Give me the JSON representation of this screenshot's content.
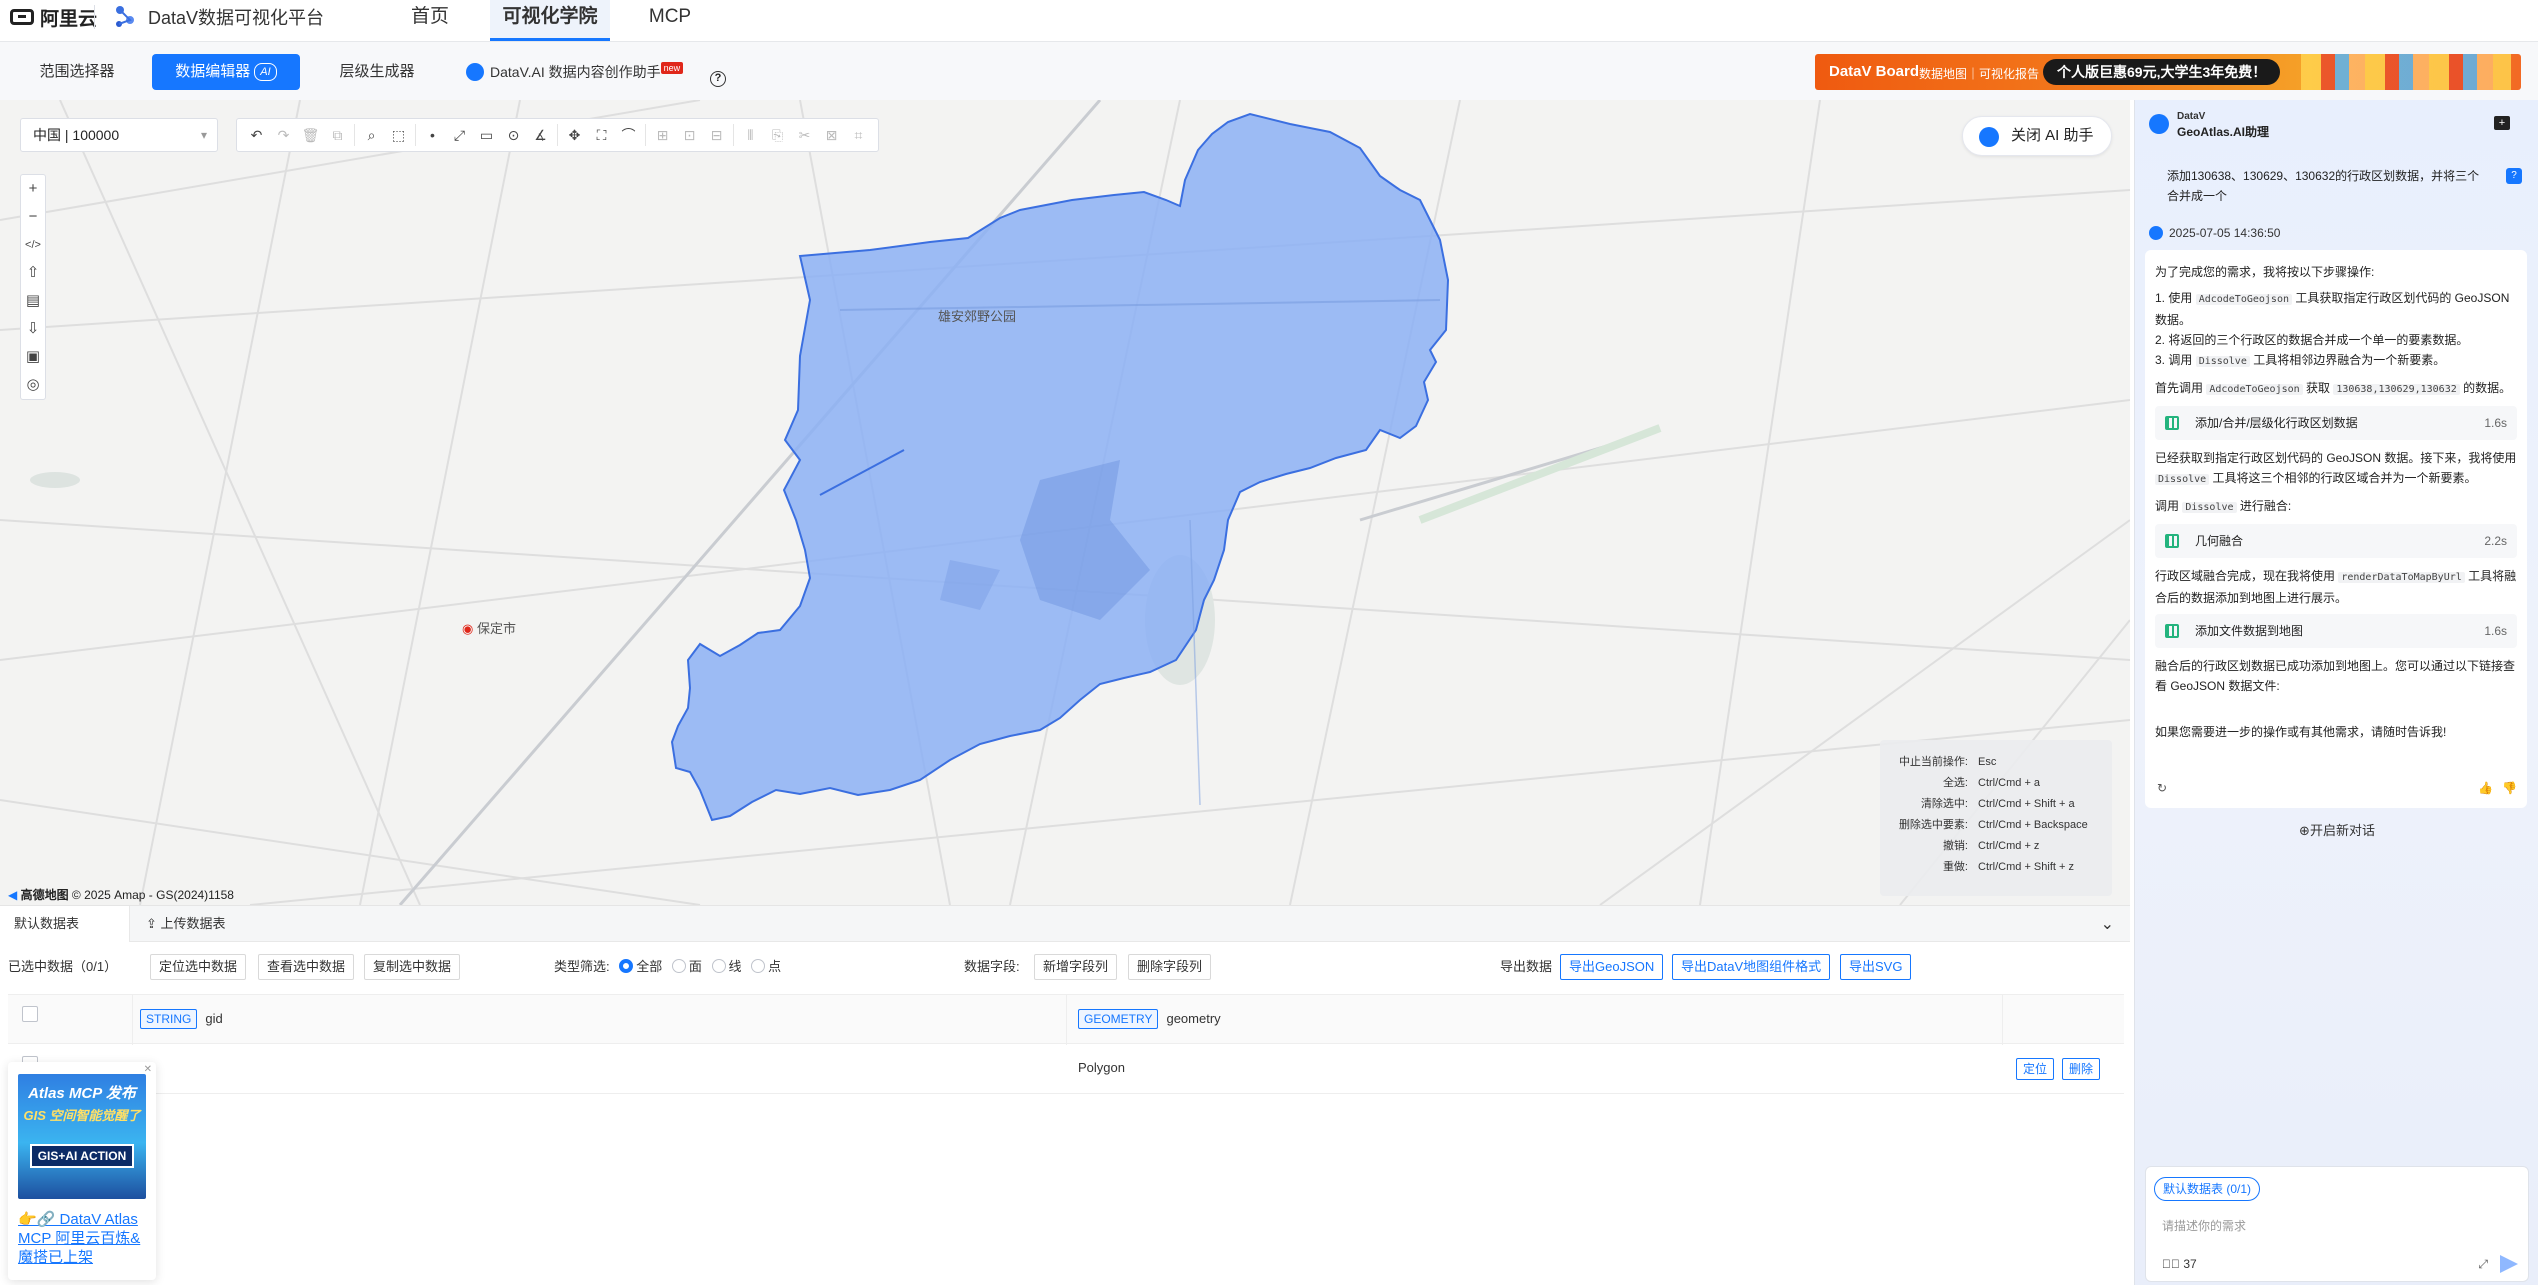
{
  "topbar": {
    "logo": "阿里云",
    "brand": "DataV数据可视化平台",
    "nav": [
      "首页",
      "可视化学院",
      "MCP"
    ],
    "active_nav": "可视化学院"
  },
  "subtabs": {
    "items": [
      "范围选择器",
      "数据编辑器",
      "层级生成器",
      "DataV.AI 数据内容创作助手"
    ],
    "active": "数据编辑器",
    "ai_badge": "AI",
    "new_badge": "new"
  },
  "banner": {
    "brand": "DataV Board",
    "sub": "数据地图｜可视化报告",
    "promo": "个人版巨惠69元,大学生3年免费！"
  },
  "map": {
    "region_select": "中国 | 100000",
    "ai_toggle": "关闭 AI 助手",
    "labels": {
      "park": "雄安郊野公园",
      "city": "保定市"
    },
    "attribution": "© 2025 Amap - GS(2024)1158",
    "amap_logo": "高德地图",
    "polygon_color": "#8cb0f5",
    "shortcuts": [
      {
        "k": "中止当前操作:",
        "v": "Esc"
      },
      {
        "k": "全选:",
        "v": "Ctrl/Cmd + a"
      },
      {
        "k": "清除选中:",
        "v": "Ctrl/Cmd + Shift + a"
      },
      {
        "k": "删除选中要素:",
        "v": "Ctrl/Cmd + Backspace"
      },
      {
        "k": "撤销:",
        "v": "Ctrl/Cmd + z"
      },
      {
        "k": "重做:",
        "v": "Ctrl/Cmd + Shift + z"
      }
    ]
  },
  "bottom": {
    "tabs": [
      "默认数据表",
      "上传数据表"
    ],
    "selected": "已选中数据（0/1）",
    "actions": [
      "定位选中数据",
      "查看选中数据",
      "复制选中数据"
    ],
    "type_filter": "类型筛选:",
    "type_options": [
      "全部",
      "面",
      "线",
      "点"
    ],
    "fields_label": "数据字段:",
    "field_actions": [
      "新增字段列",
      "删除字段列"
    ],
    "export_label": "导出数据",
    "exports": [
      "导出GeoJSON",
      "导出DataV地图组件格式",
      "导出SVG"
    ],
    "columns": [
      {
        "type": "STRING",
        "name": "gid"
      },
      {
        "type": "GEOMETRY",
        "name": "geometry"
      }
    ],
    "rows": [
      {
        "gid": "",
        "geometry": "Polygon"
      }
    ],
    "row_actions": [
      "定位",
      "删除"
    ]
  },
  "promo": {
    "title1": "Atlas MCP 发布",
    "title2": "GIS 空间智能觉醒了",
    "badge": "GIS+AI ACTION",
    "caption": "👉🔗 DataV Atlas MCP 阿里云百炼&魔搭已上架"
  },
  "assistant": {
    "brand_small": "DataV",
    "brand": "GeoAtlas.AI助理",
    "user_message": "添加130638、130629、130632的行政区划数据，并将三个合并成一个",
    "timestamp": "2025-07-05 14:36:50",
    "intro": "为了完成您的需求，我将按以下步骤操作:",
    "steps": [
      {
        "pre": "1. 使用 ",
        "code": "AdcodeToGeojson",
        "post": " 工具获取指定行政区划代码的 GeoJSON 数据。"
      },
      {
        "pre": "2. 将返回的三个行政区的数据合并成一个单一的要素数据。",
        "code": "",
        "post": ""
      },
      {
        "pre": "3. 调用 ",
        "code": "Dissolve",
        "post": " 工具将相邻边界融合为一个新要素。"
      }
    ],
    "call1_pre": "首先调用 ",
    "call1_code": "AdcodeToGeojson",
    "call1_mid": " 获取 ",
    "call1_code2": "130638,130629,130632",
    "call1_post": " 的数据。",
    "tool1": {
      "name": "添加/合并/层级化行政区划数据",
      "time": "1.6s"
    },
    "after1_pre": "已经获取到指定行政区划代码的 GeoJSON 数据。接下来，我将使用 ",
    "after1_code": "Dissolve",
    "after1_post": " 工具将这三个相邻的行政区域合并为一个新要素。",
    "call2_pre": "调用 ",
    "call2_code": "Dissolve",
    "call2_post": " 进行融合:",
    "tool2": {
      "name": "几何融合",
      "time": "2.2s"
    },
    "after2_pre": "行政区域融合完成，现在我将使用 ",
    "after2_code": "renderDataToMapByUrl",
    "after2_post": " 工具将融合后的数据添加到地图上进行展示。",
    "tool3": {
      "name": "添加文件数据到地图",
      "time": "1.6s"
    },
    "after3": "融合后的行政区划数据已成功添加到地图上。您可以通过以下链接查看 GeoJSON 数据文件:",
    "closing": "如果您需要进一步的操作或有其他需求，请随时告诉我!",
    "new_chat": "开启新对话",
    "input_chip": "默认数据表 (0/1)",
    "input_placeholder": "请描述你的需求",
    "tool_count": "37"
  }
}
